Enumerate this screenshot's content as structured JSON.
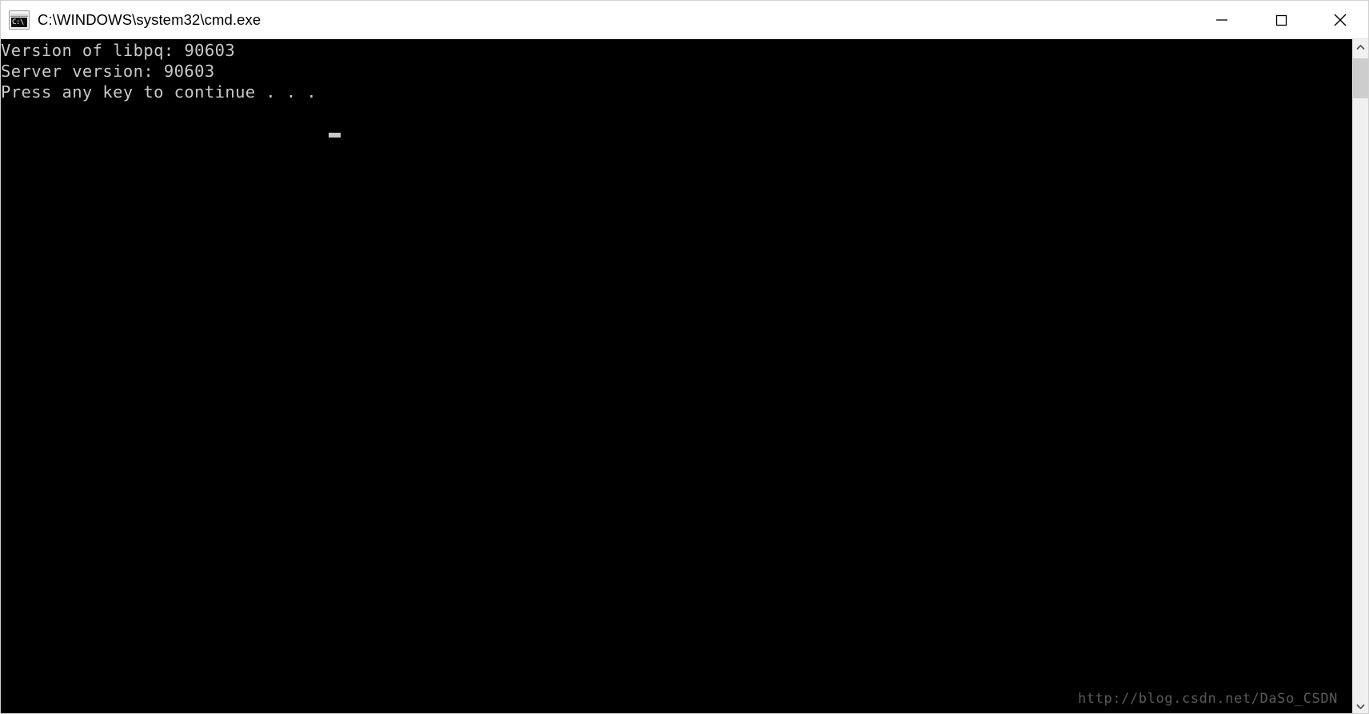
{
  "window": {
    "title": "C:\\WINDOWS\\system32\\cmd.exe",
    "icon_name": "cmd-icon",
    "icon_glyph": "C:\\",
    "controls": {
      "minimize_label": "Minimize",
      "maximize_label": "Maximize",
      "close_label": "Close"
    }
  },
  "console": {
    "background_color": "#000000",
    "text_color": "#c8c8c8",
    "lines": [
      "Version of libpq: 90603",
      "Server version: 90603",
      "Press any key to continue . . ."
    ],
    "text": "Version of libpq: 90603\nServer version: 90603\nPress any key to continue . . .",
    "cursor_visible": true
  },
  "watermark": {
    "text": "http://blog.csdn.net/DaSo_CSDN"
  },
  "scrollbar": {
    "up_arrow": "⌃",
    "down_arrow": "⌄",
    "thumb_position_percent": 0
  }
}
